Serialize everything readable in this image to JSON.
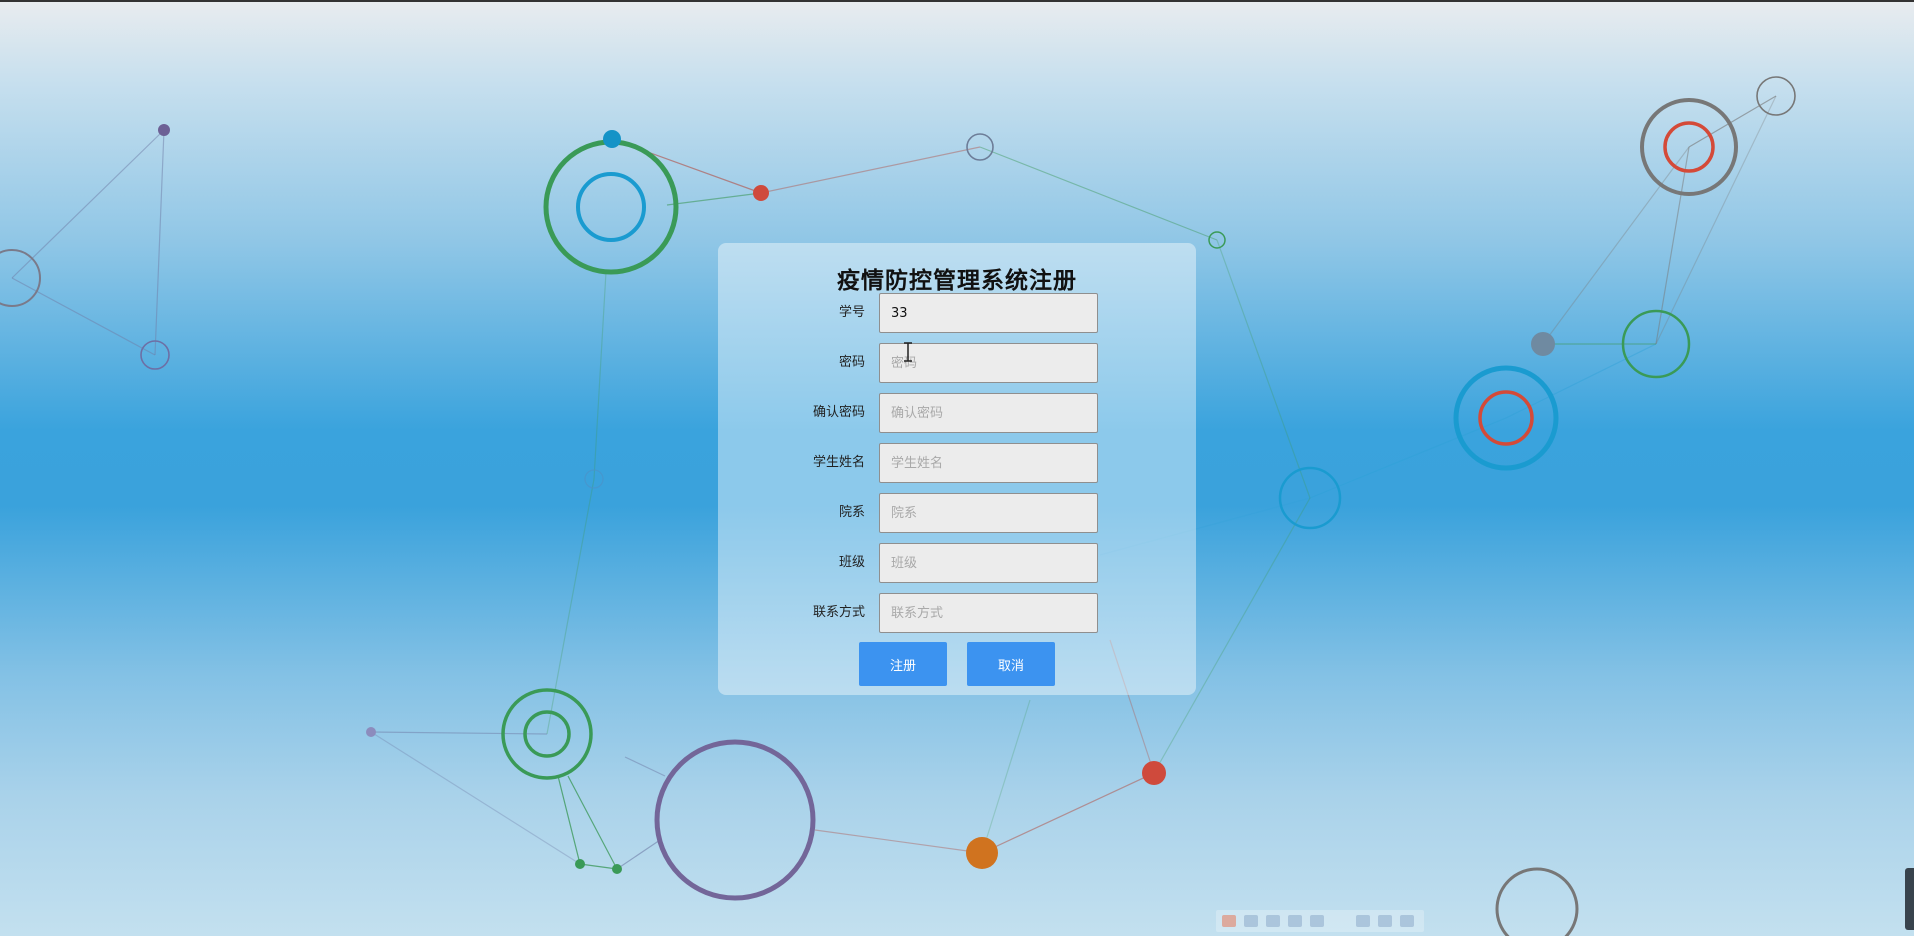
{
  "form": {
    "title": "疫情防控管理系统注册",
    "fields": [
      {
        "label": "学号",
        "value": "33",
        "placeholder": ""
      },
      {
        "label": "密码",
        "value": "",
        "placeholder": "密码"
      },
      {
        "label": "确认密码",
        "value": "",
        "placeholder": "确认密码"
      },
      {
        "label": "学生姓名",
        "value": "",
        "placeholder": "学生姓名"
      },
      {
        "label": "院系",
        "value": "",
        "placeholder": "院系"
      },
      {
        "label": "班级",
        "value": "",
        "placeholder": "班级"
      },
      {
        "label": "联系方式",
        "value": "",
        "placeholder": "联系方式"
      }
    ],
    "register_label": "注册",
    "cancel_label": "取消"
  },
  "colors": {
    "button": "#3c93f0",
    "button_text": "#ffffff",
    "input_bg": "#ececec",
    "input_border": "#8f8f8f"
  },
  "icons": [
    "i-beam-cursor-icon",
    "input-method-logo-icon",
    "tray-icons"
  ]
}
